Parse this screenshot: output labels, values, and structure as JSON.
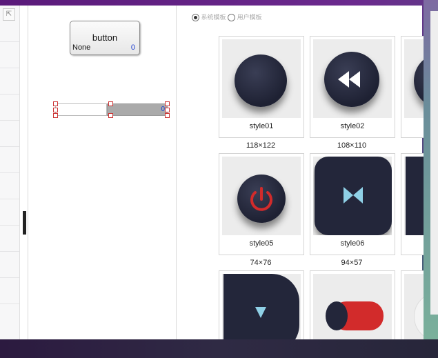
{
  "toolbar_icon": "restore-icon",
  "widget_button": {
    "title": "button",
    "name": "None",
    "value": "0"
  },
  "widget_slider": {
    "value": "0"
  },
  "template_source": {
    "system": "系统模板",
    "user": "用户模板",
    "selected": "system"
  },
  "styles": [
    {
      "label": "style01",
      "size": "118×122",
      "icon": "plain-circle"
    },
    {
      "label": "style02",
      "size": "108×110",
      "icon": "rewind-icon"
    },
    {
      "label": "",
      "size": "",
      "icon": "partial"
    },
    {
      "label": "style05",
      "size": "74×76",
      "icon": "power-icon"
    },
    {
      "label": "style06",
      "size": "94×57",
      "icon": "bowtie-icon"
    },
    {
      "label": "",
      "size": "",
      "icon": "partial"
    },
    {
      "label": "",
      "size": "",
      "icon": "down-triangle-icon"
    },
    {
      "label": "",
      "size": "",
      "icon": "toggle-cylinder"
    },
    {
      "label": "",
      "size": "",
      "icon": "partial"
    }
  ],
  "colors": {
    "accent_blue": "#1e3fd0",
    "navy": "#23263a",
    "red": "#d22b2b",
    "ice": "#8fd0e6"
  }
}
